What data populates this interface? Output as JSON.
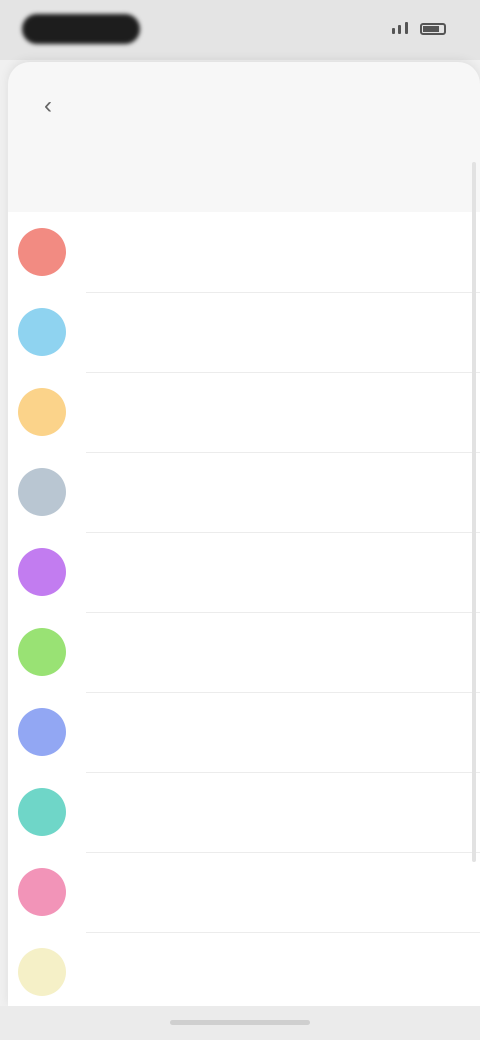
{
  "status_bar": {
    "time": "",
    "signal": "",
    "battery": ""
  },
  "nav": {
    "back_icon": "chevron-left-icon",
    "title": "",
    "action_label": ""
  },
  "section": {
    "header": ""
  },
  "colors": {
    "items": [
      {
        "label": "",
        "color": "#f28b82"
      },
      {
        "label": "",
        "color": "#8fd3f0"
      },
      {
        "label": "",
        "color": "#fbd38a"
      },
      {
        "label": "",
        "color": "#b9c6d2"
      },
      {
        "label": "",
        "color": "#c27cf0"
      },
      {
        "label": "",
        "color": "#99e274"
      },
      {
        "label": "",
        "color": "#92a7f3"
      },
      {
        "label": "",
        "color": "#6fd6c8"
      },
      {
        "label": "",
        "color": "#f294b8"
      },
      {
        "label": "",
        "color": "#f5f0c7"
      }
    ]
  }
}
